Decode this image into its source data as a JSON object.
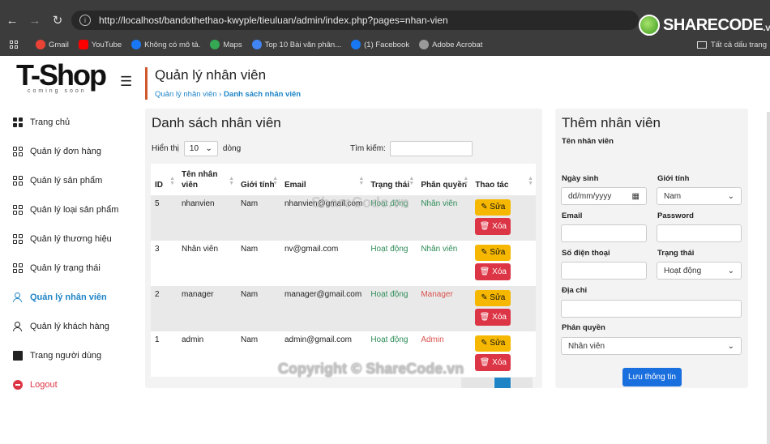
{
  "browser": {
    "url": "http://localhost/bandothethao-kwyple/tieuluan/admin/index.php?pages=nhan-vien",
    "logo_text": "SHARECODE",
    "logo_suffix": ".vn",
    "bookmarks": [
      {
        "label": "Gmail",
        "color": "#ea4335"
      },
      {
        "label": "YouTube",
        "color": "#ff0000"
      },
      {
        "label": "Không có mô tả.",
        "color": "#1877f2"
      },
      {
        "label": "Maps",
        "color": "#34a853"
      },
      {
        "label": "Top 10 Bài văn phân...",
        "color": "#4285f4"
      },
      {
        "label": "(1) Facebook",
        "color": "#1877f2"
      },
      {
        "label": "Adobe Acrobat",
        "color": "#cccccc"
      }
    ],
    "bookmarks_right": "Tất cả dấu trang"
  },
  "brand": {
    "name": "T-Shop",
    "tagline": "coming soon"
  },
  "sidebar": {
    "items": [
      {
        "label": "Trang chủ",
        "icon": "dashboard-icon"
      },
      {
        "label": "Quản lý đơn hàng",
        "icon": "grid-icon"
      },
      {
        "label": "Quản lý sản phẩm",
        "icon": "grid-icon"
      },
      {
        "label": "Quản lý loại sản phẩm",
        "icon": "grid-icon"
      },
      {
        "label": "Quản lý thương hiệu",
        "icon": "grid-icon"
      },
      {
        "label": "Quản lý trạng thái",
        "icon": "grid-icon"
      },
      {
        "label": "Quản lý nhân viên",
        "icon": "person-icon"
      },
      {
        "label": "Quản lý khách hàng",
        "icon": "people-icon"
      },
      {
        "label": "Trang người dùng",
        "icon": "monitor-icon"
      },
      {
        "label": "Logout",
        "icon": "logout-icon"
      }
    ],
    "active_index": 6
  },
  "header": {
    "title": "Quản lý nhân viên",
    "breadcrumb": [
      "Quản lý nhân viên",
      "Danh sách nhân viên"
    ]
  },
  "list": {
    "title": "Danh sách nhân viên",
    "show_prefix": "Hiển thị",
    "show_value": "10",
    "show_suffix": "dòng",
    "search_label": "Tìm kiếm:",
    "columns": [
      "ID",
      "Tên nhân viên",
      "Giới tính",
      "Email",
      "Trạng thái",
      "Phân quyền",
      "Thao tác"
    ],
    "rows": [
      {
        "id": "5",
        "name": "nhanvien",
        "gender": "Nam",
        "email": "nhanvien@gmail.com",
        "status": "Hoạt động",
        "role": "Nhân viên",
        "role_type": "staff"
      },
      {
        "id": "3",
        "name": "Nhân viên",
        "gender": "Nam",
        "email": "nv@gmail.com",
        "status": "Hoạt động",
        "role": "Nhân viên",
        "role_type": "staff"
      },
      {
        "id": "2",
        "name": "manager",
        "gender": "Nam",
        "email": "manager@gmail.com",
        "status": "Hoạt động",
        "role": "Manager",
        "role_type": "admin"
      },
      {
        "id": "1",
        "name": "admin",
        "gender": "Nam",
        "email": "admin@gmail.com",
        "status": "Hoạt động",
        "role": "Admin",
        "role_type": "admin"
      }
    ],
    "edit_label": "Sửa",
    "delete_label": "Xóa"
  },
  "form": {
    "title": "Thêm nhân viên",
    "name_label": "Tên nhân viên",
    "dob_label": "Ngày sinh",
    "dob_placeholder": "dd/mm/yyyy",
    "gender_label": "Giới tính",
    "gender_value": "Nam",
    "email_label": "Email",
    "password_label": "Password",
    "phone_label": "Số điện thoại",
    "status_label": "Trạng thái",
    "status_value": "Hoạt động",
    "address_label": "Địa chỉ",
    "role_label": "Phân quyền",
    "role_value": "Nhân viên",
    "save_label": "Lưu thông tin"
  },
  "watermarks": {
    "center": "ShareCode.vn",
    "bottom": "Copyright © ShareCode.vn"
  },
  "colors": {
    "accent": "#1e84c6",
    "edit": "#f6b700",
    "delete": "#dc3545",
    "status": "#2e8b57",
    "save": "#1a6fde"
  }
}
